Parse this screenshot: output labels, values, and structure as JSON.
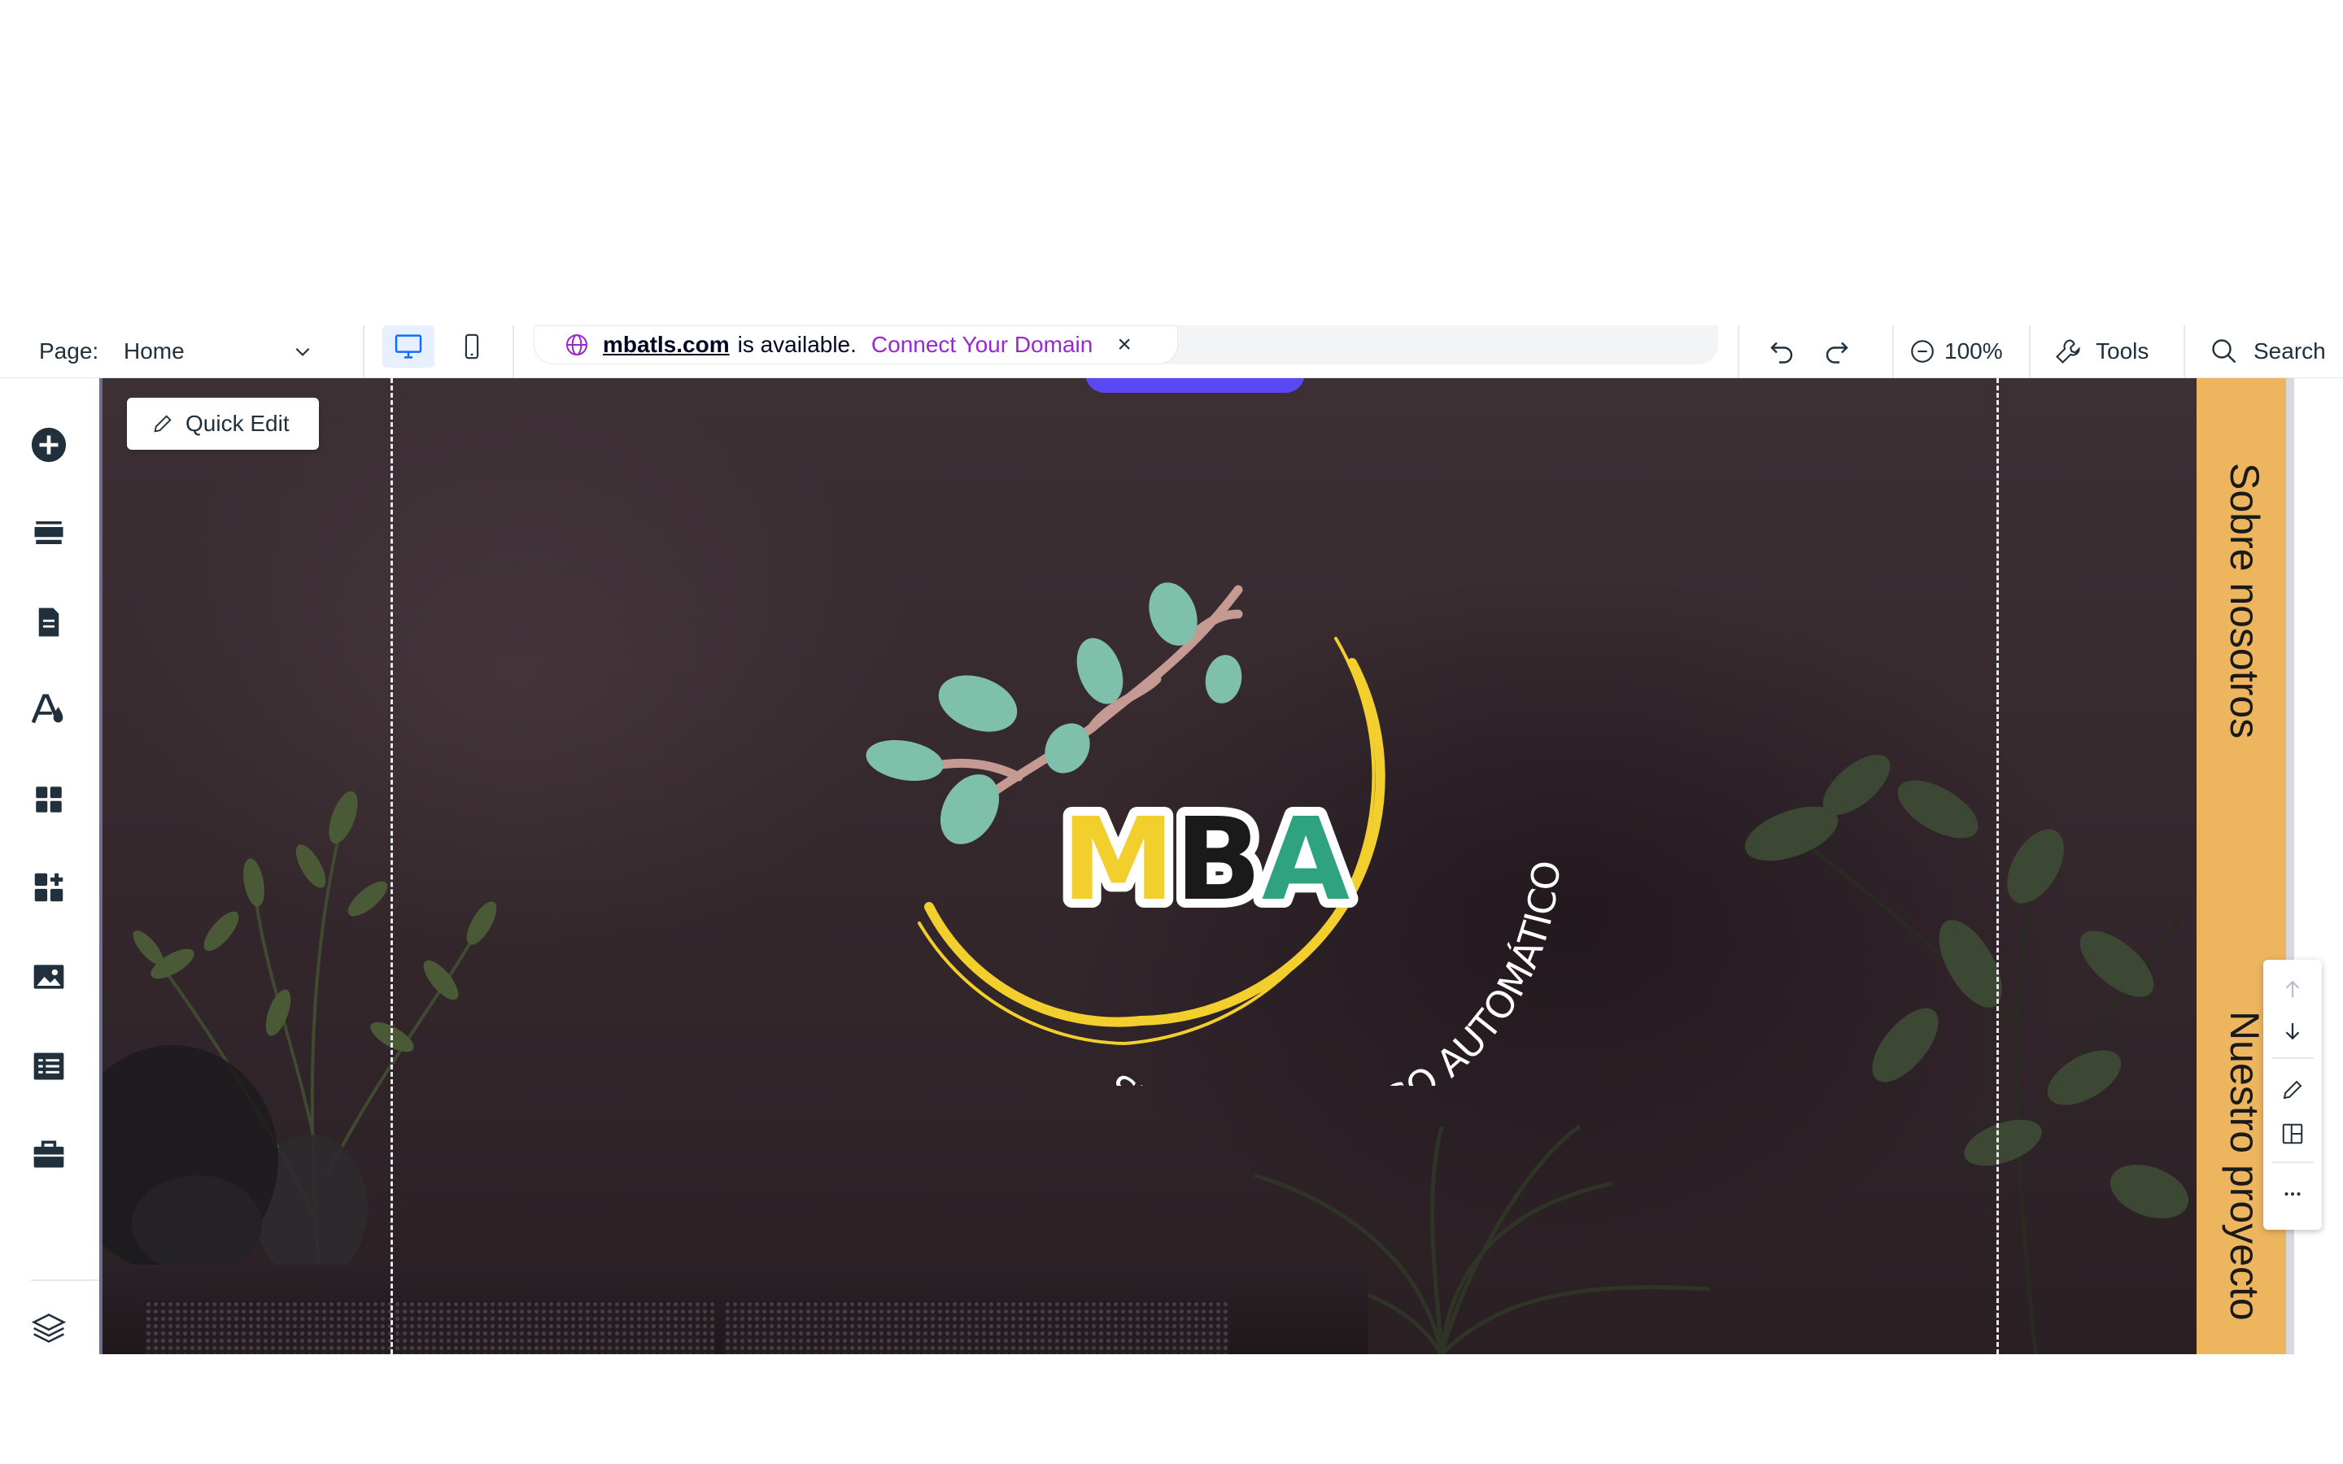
{
  "topbar": {
    "page_label": "Page:",
    "page_value": "Home",
    "domain_name": "mbatls.com",
    "domain_available": "is available.",
    "connect_domain": "Connect Your Domain",
    "close_glyph": "×",
    "zoom": "100%",
    "tools": "Tools",
    "search": "Search"
  },
  "canvas": {
    "quick_edit": "Quick Edit",
    "logo": {
      "brand": "MBA",
      "tagline": "SISTEMA DE RIEGO AUTOMÁTICO"
    }
  },
  "nav": {
    "items": [
      "Sobre nosotros",
      "Nuestro proyecto"
    ]
  },
  "leftbar": {
    "icons": [
      "add-icon",
      "sections-icon",
      "pages-icon",
      "theme-icon",
      "apps-icon",
      "add-apps-icon",
      "media-icon",
      "cms-icon",
      "business-icon",
      "layers-icon"
    ]
  },
  "colors": {
    "accent": "#116dff",
    "connect": "#9a27d5",
    "nav_bg": "#edb55e",
    "canvas_bg": "#33272c",
    "logo_yellow": "#f2cf2c",
    "logo_leaf": "#7ec0aa"
  }
}
